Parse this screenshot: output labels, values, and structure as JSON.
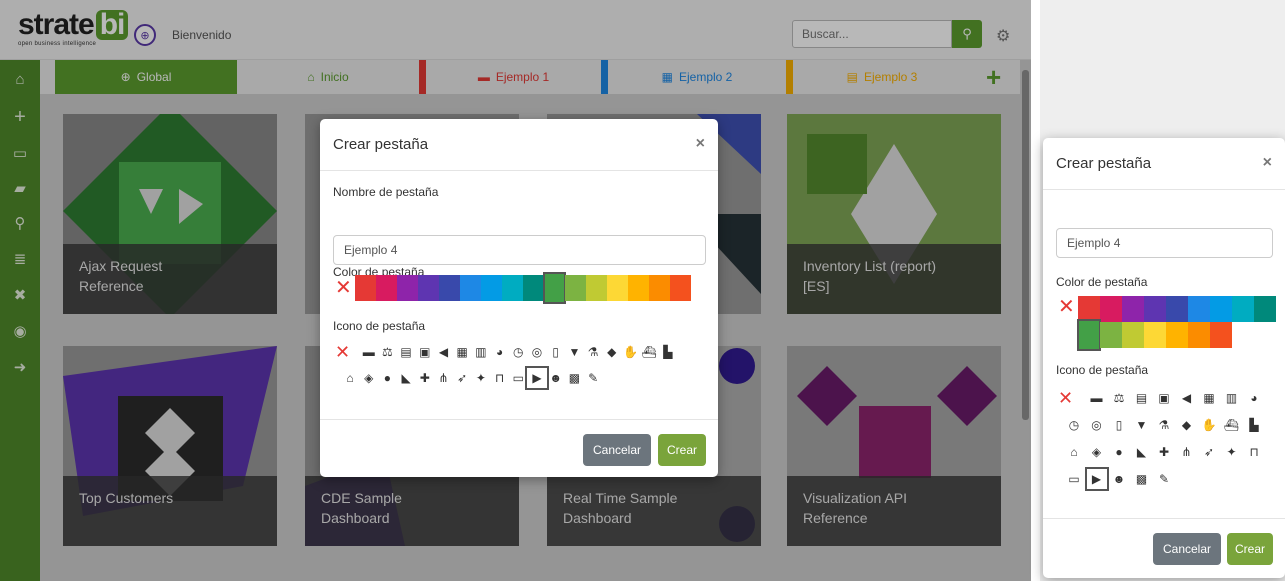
{
  "header": {
    "logo_main": "strate",
    "logo_bi": "bi",
    "logo_sub": "open business intelligence",
    "welcome": "Bienvenido",
    "search_placeholder": "Buscar..."
  },
  "tabs": [
    {
      "label": "Global",
      "icon": "globe-icon",
      "color": "#5c9d2f"
    },
    {
      "label": "Inicio",
      "icon": "home-icon",
      "color": "#5c9d2f"
    },
    {
      "label": "Ejemplo 1",
      "icon": "archive-icon",
      "color": "#e53935"
    },
    {
      "label": "Ejemplo 2",
      "icon": "calendar-icon",
      "color": "#1e88e5"
    },
    {
      "label": "Ejemplo 3",
      "icon": "coins-icon",
      "color": "#f9b000"
    }
  ],
  "cards": [
    {
      "title_line1": "Ajax Request",
      "title_line2": "Reference"
    },
    {
      "title_line1": "Inventory List (report)",
      "title_line2": "[ES]"
    },
    {
      "title_line1": "Top Customers",
      "title_line2": ""
    },
    {
      "title_line1": "CDE Sample",
      "title_line2": "Dashboard"
    },
    {
      "title_line1": "Real Time Sample",
      "title_line2": "Dashboard"
    },
    {
      "title_line1": "Visualization API",
      "title_line2": "Reference"
    }
  ],
  "modal": {
    "title": "Crear pestaña",
    "name_label": "Nombre de pestaña",
    "name_value": "Ejemplo 4",
    "color_label": "Color de pestaña",
    "icon_label": "Icono de pestaña",
    "cancel": "Cancelar",
    "create": "Crear",
    "colors": [
      "#e53935",
      "#d81b60",
      "#8e24aa",
      "#5e35b1",
      "#3949ab",
      "#1e88e5",
      "#039be5",
      "#00acc1",
      "#00897b",
      "#43a047",
      "#7cb342",
      "#c0ca33",
      "#fdd835",
      "#ffb300",
      "#fb8c00",
      "#f4511e"
    ],
    "selected_color": "#43a047",
    "icons": [
      "archive-icon",
      "balance-icon",
      "book-icon",
      "briefcase-icon",
      "bullhorn-icon",
      "calendar-icon",
      "chart-icon",
      "pie-chart-icon",
      "clock-icon",
      "coins-icon",
      "file-icon",
      "filter-icon",
      "flask-icon",
      "graduation-icon",
      "handshake-icon",
      "ship-icon",
      "industry-icon",
      "bank-icon",
      "layers-icon",
      "bulb-icon",
      "map-icon",
      "medkit-icon",
      "network-icon",
      "rocket-icon",
      "satellite-icon",
      "cart-icon",
      "store-icon",
      "truck-icon",
      "users-icon",
      "warehouse-icon",
      "wrench-icon"
    ],
    "selected_icon": "truck-icon"
  }
}
